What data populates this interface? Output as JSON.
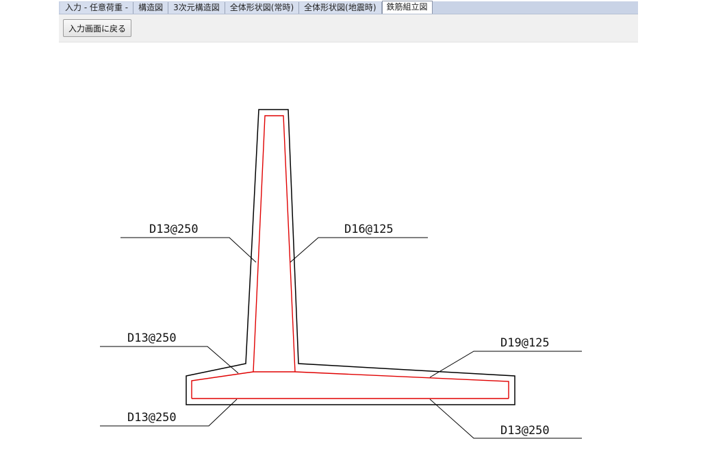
{
  "tabs": [
    {
      "label": "入力 - 任意荷重 -",
      "active": false
    },
    {
      "label": "構造図",
      "active": false
    },
    {
      "label": "3次元構造図",
      "active": false
    },
    {
      "label": "全体形状図(常時)",
      "active": false
    },
    {
      "label": "全体形状図(地震時)",
      "active": false
    },
    {
      "label": "鉄筋組立図",
      "active": true
    }
  ],
  "toolbar": {
    "back_label": "入力画面に戻る"
  },
  "rebar_labels": {
    "wall_left": "D13@250",
    "wall_right": "D16@125",
    "toe_top": "D13@250",
    "heel_top": "D19@125",
    "bottom_left": "D13@250",
    "bottom_right": "D13@250"
  },
  "colors": {
    "outline": "#000000",
    "rebar": "#e00000",
    "tab_bar": "#c9d3e6"
  }
}
